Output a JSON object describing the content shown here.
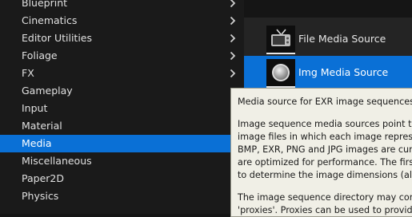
{
  "category_menu": {
    "items": [
      {
        "label": "Blueprint",
        "has_submenu": true
      },
      {
        "label": "Cinematics",
        "has_submenu": true
      },
      {
        "label": "Editor Utilities",
        "has_submenu": true
      },
      {
        "label": "Foliage",
        "has_submenu": true
      },
      {
        "label": "FX",
        "has_submenu": true
      },
      {
        "label": "Gameplay",
        "has_submenu": false
      },
      {
        "label": "Input",
        "has_submenu": false
      },
      {
        "label": "Material",
        "has_submenu": false
      },
      {
        "label": "Media",
        "has_submenu": false,
        "selected": true
      },
      {
        "label": "Miscellaneous",
        "has_submenu": false
      },
      {
        "label": "Paper2D",
        "has_submenu": false
      },
      {
        "label": "Physics",
        "has_submenu": false
      }
    ]
  },
  "submenu": {
    "items": [
      {
        "label": "File Media Source",
        "icon": "tv-icon"
      },
      {
        "label": "Img Media Source",
        "icon": "sphere-icon",
        "selected": true
      }
    ]
  },
  "tooltip": {
    "lines": [
      "Media source for EXR image sequences.",
      "",
      "Image sequence media sources point to a",
      "image files in which each image represen",
      "BMP, EXR, PNG and JPG images are curr",
      "are optimized for performance. The first f",
      "to determine the image dimensions (all fo",
      "",
      "The image sequence directory may conta",
      "'proxies'. Proxies can be used to provide"
    ]
  },
  "colors": {
    "selection": "#0a70d6",
    "menu_bg": "#1a1a1a",
    "submenu_bg": "#242424",
    "tooltip_bg": "#f0efe6"
  }
}
